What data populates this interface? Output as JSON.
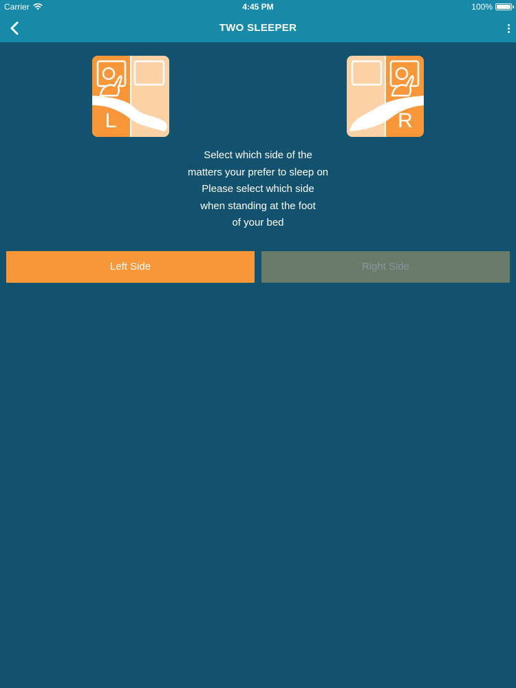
{
  "status_bar": {
    "carrier": "Carrier",
    "time": "4:45 PM",
    "battery": "100%",
    "battery_level": 1.0
  },
  "nav": {
    "title": "TWO SLEEPER",
    "back_icon": "chevron-left-icon",
    "more_icon": "vertical-dots-icon"
  },
  "tiles": {
    "left_letter": "L",
    "right_letter": "R"
  },
  "instructions": {
    "lines": [
      "Select which side of the",
      "matters your prefer to sleep on",
      "Please select which side",
      "when standing at the foot",
      "of your bed"
    ]
  },
  "buttons": {
    "left_label": "Left Side",
    "right_label": "Right Side"
  },
  "colors": {
    "background": "#13526f",
    "nav_bar": "#1789a9",
    "accent_orange": "#f7973a",
    "tile_light": "#fbd2a6",
    "right_button_inactive": "#6a7a69"
  }
}
